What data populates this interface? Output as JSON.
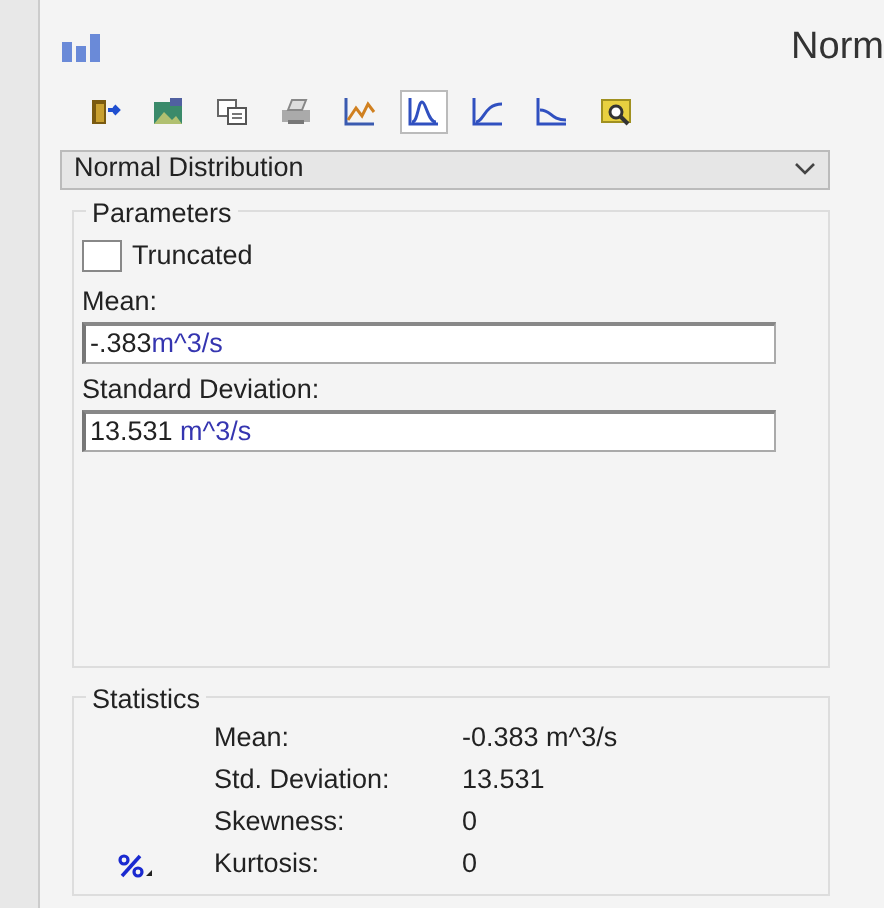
{
  "window": {
    "title": "Norm"
  },
  "toolbar": [
    {
      "kind": "exit",
      "selected": false
    },
    {
      "kind": "image",
      "selected": false
    },
    {
      "kind": "copy",
      "selected": false
    },
    {
      "kind": "print",
      "selected": false
    },
    {
      "kind": "plot",
      "selected": false
    },
    {
      "kind": "pdf",
      "selected": true
    },
    {
      "kind": "cdf",
      "selected": false
    },
    {
      "kind": "survival",
      "selected": false
    },
    {
      "kind": "zoom",
      "selected": false
    }
  ],
  "distribution": {
    "value": "Normal Distribution"
  },
  "parameters": {
    "title": "Parameters",
    "truncated": {
      "label": "Truncated",
      "checked": false
    },
    "fields": [
      {
        "label": "Mean:",
        "number": "-.383",
        "unit": "m^3/s"
      },
      {
        "label": "Standard Deviation:",
        "number": "13.531 ",
        "unit": "m^3/s"
      }
    ]
  },
  "statistics": {
    "title": "Statistics",
    "rows": [
      {
        "label": "Mean:",
        "value": "-0.383 m^3/s"
      },
      {
        "label": "Std. Deviation:",
        "value": "13.531"
      },
      {
        "label": "Skewness:",
        "value": "0"
      },
      {
        "label": "Kurtosis:",
        "value": "0",
        "icon": true
      }
    ]
  }
}
